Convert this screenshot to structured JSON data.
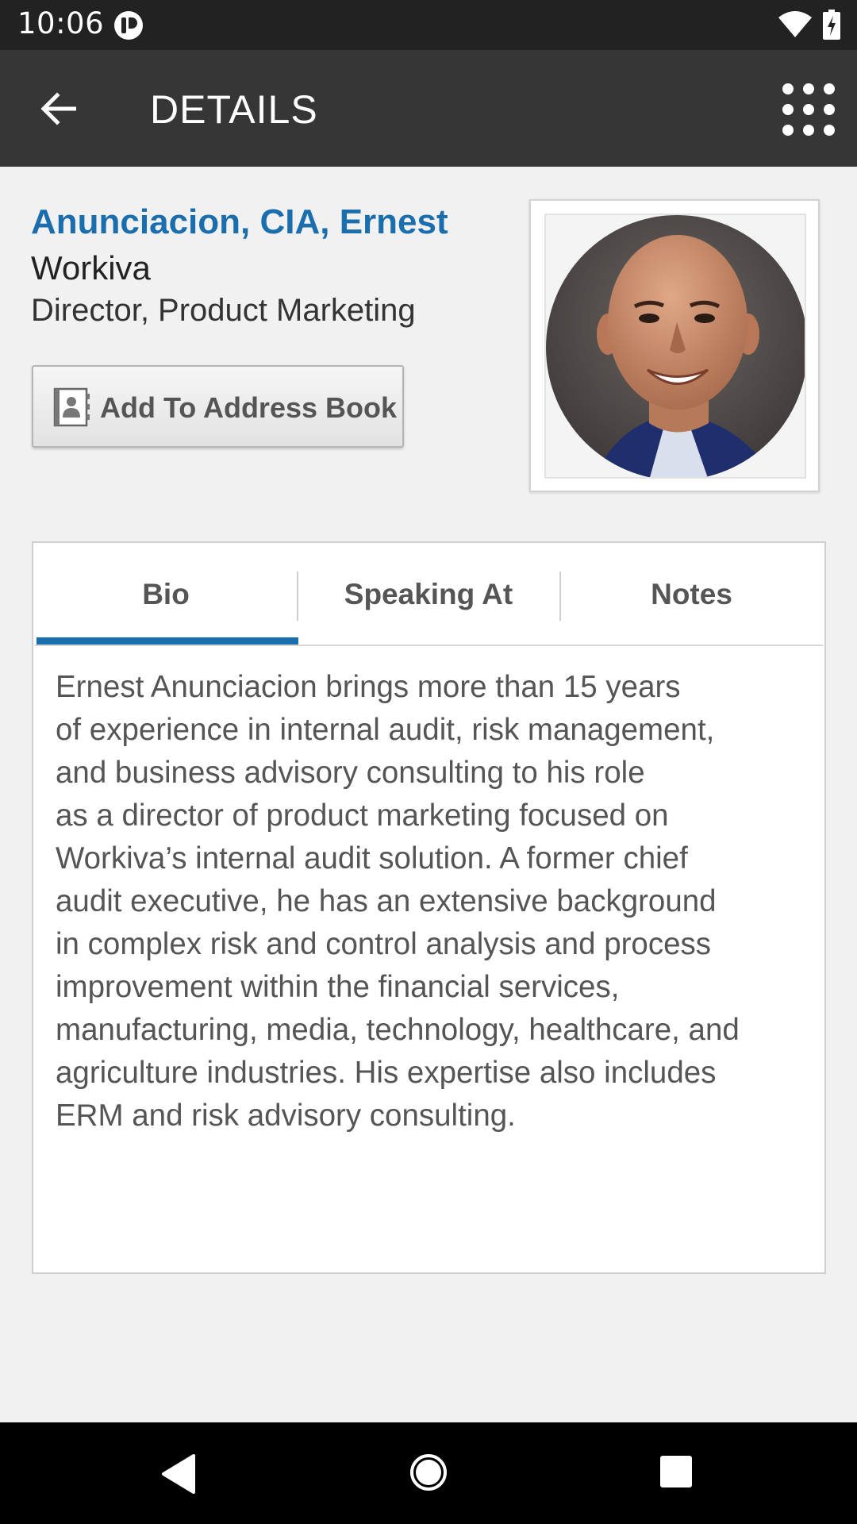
{
  "status_bar": {
    "time": "10:06",
    "icons": [
      "notification-app-icon",
      "wifi-icon",
      "battery-charging-icon"
    ]
  },
  "app_bar": {
    "title": "DETAILS",
    "back_icon": "arrow-left-icon",
    "menu_icon": "grid-dots-icon"
  },
  "profile": {
    "name": "Anunciacion, CIA, Ernest",
    "company": "Workiva",
    "position": "Director, Product Marketing",
    "add_button_label": "Add To Address Book",
    "add_button_icon": "address-book-icon"
  },
  "tabs": {
    "items": [
      {
        "label": "Bio"
      },
      {
        "label": "Speaking At"
      },
      {
        "label": "Notes"
      }
    ],
    "active": "Bio"
  },
  "bio": {
    "lines": [
      "Ernest Anunciacion brings more than 15 years",
      "of experience in internal audit, risk management,",
      "and business advisory consulting to his role",
      "as a director of product marketing focused on",
      "Workiva’s internal audit solution. A former chief",
      "audit executive, he has an extensive background",
      "in complex risk and control analysis and process",
      "improvement within the financial services,",
      "manufacturing, media, technology, healthcare, and",
      "agriculture industries. His expertise also includes",
      "ERM and risk advisory consulting."
    ]
  },
  "colors": {
    "accent": "#1a6ead",
    "app_bar": "#363636",
    "status_bar": "#222222",
    "background": "#f1f1f1"
  }
}
